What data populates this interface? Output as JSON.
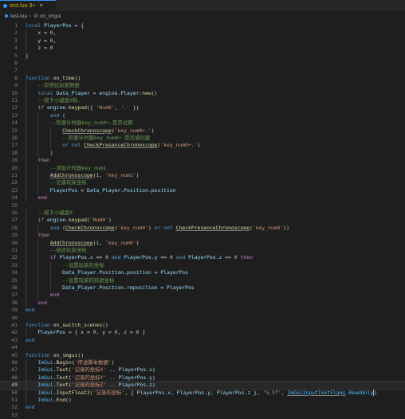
{
  "tab": {
    "name": "test.lua",
    "badge": "9+",
    "close": "×"
  },
  "breadcrumb": {
    "file": "test.lua",
    "separator": "›",
    "fn_icon": "⊘",
    "function": "on_imgui"
  },
  "current_line": 49,
  "lines": [
    [
      {
        "t": "local",
        "c": "kw"
      },
      {
        "t": " "
      },
      {
        "t": "PlayerPos",
        "c": "var"
      },
      {
        "t": " = {"
      }
    ],
    [
      {
        "t": "    "
      },
      {
        "t": "x",
        "c": "var"
      },
      {
        "t": " = "
      },
      {
        "t": "0",
        "c": "num"
      },
      {
        "t": ","
      }
    ],
    [
      {
        "t": "    "
      },
      {
        "t": "y",
        "c": "var"
      },
      {
        "t": " = "
      },
      {
        "t": "0",
        "c": "num"
      },
      {
        "t": ","
      }
    ],
    [
      {
        "t": "    "
      },
      {
        "t": "z",
        "c": "var"
      },
      {
        "t": " = "
      },
      {
        "t": "0",
        "c": "num"
      }
    ],
    [
      {
        "t": "}"
      }
    ],
    [],
    [],
    [
      {
        "t": "function",
        "c": "kw"
      },
      {
        "t": " "
      },
      {
        "t": "on_time",
        "c": "fn"
      },
      {
        "t": "()"
      }
    ],
    [
      {
        "t": "    "
      },
      {
        "t": "--实例化玩家数据",
        "c": "cmt"
      }
    ],
    [
      {
        "t": "    "
      },
      {
        "t": "local",
        "c": "kw"
      },
      {
        "t": " "
      },
      {
        "t": "Data_Player",
        "c": "var"
      },
      {
        "t": " = "
      },
      {
        "t": "engine",
        "c": "var"
      },
      {
        "t": "."
      },
      {
        "t": "Player",
        "c": "var"
      },
      {
        "t": ":"
      },
      {
        "t": "new",
        "c": "fn"
      },
      {
        "t": "()"
      }
    ],
    [
      {
        "t": "    "
      },
      {
        "t": "--按下小键盘0和.",
        "c": "cmt"
      }
    ],
    [
      {
        "t": "    "
      },
      {
        "t": "if",
        "c": "ctl"
      },
      {
        "t": " "
      },
      {
        "t": "engine",
        "c": "var"
      },
      {
        "t": "."
      },
      {
        "t": "keypad",
        "c": "fn"
      },
      {
        "t": "({ "
      },
      {
        "t": "'Num0'",
        "c": "str"
      },
      {
        "t": ", "
      },
      {
        "t": "'.'",
        "c": "str"
      },
      {
        "t": " })"
      }
    ],
    [
      {
        "t": "        "
      },
      {
        "t": "and",
        "c": "kw"
      },
      {
        "t": " ("
      }
    ],
    [
      {
        "t": "        "
      },
      {
        "t": "--检查计时器key_num0+.是否过期",
        "c": "cmt"
      }
    ],
    [
      {
        "t": "            "
      },
      {
        "t": "CheckChronoscope",
        "c": "fn",
        "u": true
      },
      {
        "t": "("
      },
      {
        "t": "'key_num0+.'",
        "c": "str"
      },
      {
        "t": ")"
      }
    ],
    [
      {
        "t": "            "
      },
      {
        "t": "--检查计时器key_num0+.是否被创建",
        "c": "cmt"
      }
    ],
    [
      {
        "t": "            "
      },
      {
        "t": "or",
        "c": "kw"
      },
      {
        "t": " "
      },
      {
        "t": "not",
        "c": "kw"
      },
      {
        "t": " "
      },
      {
        "t": "CheckPresenceChronoscope",
        "c": "fn",
        "u": true
      },
      {
        "t": "("
      },
      {
        "t": "'key_num0+.'",
        "c": "str"
      },
      {
        "t": ")"
      }
    ],
    [
      {
        "t": "        "
      },
      {
        "t": ")"
      }
    ],
    [
      {
        "t": "    "
      },
      {
        "t": "then",
        "c": "ctl"
      }
    ],
    [
      {
        "t": "        "
      },
      {
        "t": "--添加计时器key_num1",
        "c": "cmt"
      }
    ],
    [
      {
        "t": "        "
      },
      {
        "t": "AddChronoscope",
        "c": "fn",
        "u": true
      },
      {
        "t": "("
      },
      {
        "t": "1",
        "c": "num"
      },
      {
        "t": ", "
      },
      {
        "t": "'key_num1'",
        "c": "str"
      },
      {
        "t": ")"
      }
    ],
    [
      {
        "t": "        "
      },
      {
        "t": "--记录玩家坐标",
        "c": "cmt"
      }
    ],
    [
      {
        "t": "        "
      },
      {
        "t": "PlayerPos",
        "c": "var"
      },
      {
        "t": " = "
      },
      {
        "t": "Data_Player",
        "c": "var"
      },
      {
        "t": "."
      },
      {
        "t": "Position",
        "c": "var"
      },
      {
        "t": "."
      },
      {
        "t": "position",
        "c": "var"
      }
    ],
    [
      {
        "t": "    "
      },
      {
        "t": "end",
        "c": "ctl"
      }
    ],
    [],
    [
      {
        "t": "    "
      },
      {
        "t": "--按下小键盘0",
        "c": "cmt"
      }
    ],
    [
      {
        "t": "    "
      },
      {
        "t": "if",
        "c": "ctl"
      },
      {
        "t": " "
      },
      {
        "t": "engine",
        "c": "var"
      },
      {
        "t": "."
      },
      {
        "t": "keypad",
        "c": "fn"
      },
      {
        "t": "("
      },
      {
        "t": "'Num0'",
        "c": "str"
      },
      {
        "t": ")"
      }
    ],
    [
      {
        "t": "        "
      },
      {
        "t": "and",
        "c": "kw"
      },
      {
        "t": " ("
      },
      {
        "t": "CheckChronoscope",
        "c": "fn",
        "u": true
      },
      {
        "t": "("
      },
      {
        "t": "'key_num0'",
        "c": "str"
      },
      {
        "t": ") "
      },
      {
        "t": "or",
        "c": "kw"
      },
      {
        "t": " "
      },
      {
        "t": "not",
        "c": "kw"
      },
      {
        "t": " "
      },
      {
        "t": "CheckPresenceChronoscope",
        "c": "fn",
        "u": true
      },
      {
        "t": "("
      },
      {
        "t": "'key_num0'",
        "c": "str"
      },
      {
        "t": "))"
      }
    ],
    [
      {
        "t": "    "
      },
      {
        "t": "then",
        "c": "ctl"
      }
    ],
    [
      {
        "t": "        "
      },
      {
        "t": "AddChronoscope",
        "c": "fn",
        "u": true
      },
      {
        "t": "("
      },
      {
        "t": "1",
        "c": "num"
      },
      {
        "t": ", "
      },
      {
        "t": "'key_num0'",
        "c": "str"
      },
      {
        "t": ")"
      }
    ],
    [
      {
        "t": "        "
      },
      {
        "t": "--给还玩家坐标",
        "c": "cmt"
      }
    ],
    [
      {
        "t": "        "
      },
      {
        "t": "if",
        "c": "ctl"
      },
      {
        "t": " "
      },
      {
        "t": "PlayerPos",
        "c": "var"
      },
      {
        "t": "."
      },
      {
        "t": "x",
        "c": "var"
      },
      {
        "t": " == "
      },
      {
        "t": "0",
        "c": "num"
      },
      {
        "t": " "
      },
      {
        "t": "and",
        "c": "kw"
      },
      {
        "t": " "
      },
      {
        "t": "PlayerPos",
        "c": "var"
      },
      {
        "t": "."
      },
      {
        "t": "y",
        "c": "var"
      },
      {
        "t": " == "
      },
      {
        "t": "0",
        "c": "num"
      },
      {
        "t": " "
      },
      {
        "t": "and",
        "c": "kw"
      },
      {
        "t": " "
      },
      {
        "t": "PlayerPos",
        "c": "var"
      },
      {
        "t": "."
      },
      {
        "t": "z",
        "c": "var"
      },
      {
        "t": " == "
      },
      {
        "t": "0",
        "c": "num"
      },
      {
        "t": " "
      },
      {
        "t": "then",
        "c": "ctl"
      }
    ],
    [
      {
        "t": "            "
      },
      {
        "t": "--设置玩家的坐标",
        "c": "cmt"
      }
    ],
    [
      {
        "t": "            "
      },
      {
        "t": "Data_Player",
        "c": "var"
      },
      {
        "t": "."
      },
      {
        "t": "Position",
        "c": "var"
      },
      {
        "t": "."
      },
      {
        "t": "position",
        "c": "var"
      },
      {
        "t": " = "
      },
      {
        "t": "PlayerPos",
        "c": "var"
      }
    ],
    [
      {
        "t": "            "
      },
      {
        "t": "--设置玩家的前进坐标",
        "c": "cmt"
      }
    ],
    [
      {
        "t": "            "
      },
      {
        "t": "Data_Player",
        "c": "var"
      },
      {
        "t": "."
      },
      {
        "t": "Position",
        "c": "var"
      },
      {
        "t": "."
      },
      {
        "t": "reposition",
        "c": "var"
      },
      {
        "t": " = "
      },
      {
        "t": "PlayerPos",
        "c": "var"
      }
    ],
    [
      {
        "t": "        "
      },
      {
        "t": "end",
        "c": "ctl"
      }
    ],
    [
      {
        "t": "    "
      },
      {
        "t": "end",
        "c": "ctl"
      }
    ],
    [
      {
        "t": "end",
        "c": "kw"
      }
    ],
    [],
    [
      {
        "t": "function",
        "c": "kw"
      },
      {
        "t": " "
      },
      {
        "t": "on_switch_scenes",
        "c": "fn"
      },
      {
        "t": "()"
      }
    ],
    [
      {
        "t": "    "
      },
      {
        "t": "PlayerPos",
        "c": "var"
      },
      {
        "t": " = { "
      },
      {
        "t": "x",
        "c": "var"
      },
      {
        "t": " = "
      },
      {
        "t": "0",
        "c": "num"
      },
      {
        "t": ", "
      },
      {
        "t": "y",
        "c": "var"
      },
      {
        "t": " = "
      },
      {
        "t": "0",
        "c": "num"
      },
      {
        "t": ", "
      },
      {
        "t": "z",
        "c": "var"
      },
      {
        "t": " = "
      },
      {
        "t": "0",
        "c": "num"
      },
      {
        "t": " }"
      }
    ],
    [
      {
        "t": "end",
        "c": "kw"
      }
    ],
    [],
    [
      {
        "t": "function",
        "c": "kw"
      },
      {
        "t": " "
      },
      {
        "t": "on_imgui",
        "c": "fn"
      },
      {
        "t": "()"
      }
    ],
    [
      {
        "t": "    "
      },
      {
        "t": "ImGui",
        "c": "glb"
      },
      {
        "t": "."
      },
      {
        "t": "Begin",
        "c": "fn"
      },
      {
        "t": "("
      },
      {
        "t": "'传送脚本数据'",
        "c": "str"
      },
      {
        "t": ")"
      }
    ],
    [
      {
        "t": "    "
      },
      {
        "t": "ImGui",
        "c": "glb"
      },
      {
        "t": "."
      },
      {
        "t": "Text",
        "c": "fn"
      },
      {
        "t": "("
      },
      {
        "t": "'记录的坐标X' ",
        "c": "str"
      },
      {
        "t": ".. "
      },
      {
        "t": "PlayerPos",
        "c": "var"
      },
      {
        "t": "."
      },
      {
        "t": "x",
        "c": "var"
      },
      {
        "t": ")"
      }
    ],
    [
      {
        "t": "    "
      },
      {
        "t": "ImGui",
        "c": "glb"
      },
      {
        "t": "."
      },
      {
        "t": "Text",
        "c": "fn"
      },
      {
        "t": "("
      },
      {
        "t": "'记录的坐标Y' ",
        "c": "str"
      },
      {
        "t": ".. "
      },
      {
        "t": "PlayerPos",
        "c": "var"
      },
      {
        "t": "."
      },
      {
        "t": "y",
        "c": "var"
      },
      {
        "t": ")"
      }
    ],
    [
      {
        "t": "    "
      },
      {
        "t": "ImGui",
        "c": "glb"
      },
      {
        "t": "."
      },
      {
        "t": "Text",
        "c": "fn"
      },
      {
        "t": "("
      },
      {
        "t": "'记录的坐标Z' ",
        "c": "str"
      },
      {
        "t": ".. "
      },
      {
        "t": "PlayerPos",
        "c": "var"
      },
      {
        "t": "."
      },
      {
        "t": "z",
        "c": "var"
      },
      {
        "t": ")"
      }
    ],
    [
      {
        "t": "    "
      },
      {
        "t": "ImGui",
        "c": "glb"
      },
      {
        "t": "."
      },
      {
        "t": "InputFloat3",
        "c": "fn"
      },
      {
        "t": "("
      },
      {
        "t": "'记录的坐标'",
        "c": "str"
      },
      {
        "t": ", { "
      },
      {
        "t": "PlayerPos",
        "c": "var"
      },
      {
        "t": "."
      },
      {
        "t": "x",
        "c": "var"
      },
      {
        "t": ", "
      },
      {
        "t": "PlayerPos",
        "c": "var"
      },
      {
        "t": "."
      },
      {
        "t": "y",
        "c": "var"
      },
      {
        "t": ", "
      },
      {
        "t": "PlayerPos",
        "c": "var"
      },
      {
        "t": "."
      },
      {
        "t": "z",
        "c": "var"
      },
      {
        "t": " }, "
      },
      {
        "t": "'%.5f'",
        "c": "str"
      },
      {
        "t": ", "
      },
      {
        "t": "ImGuiInputTextFlags",
        "c": "glb",
        "u": true
      },
      {
        "t": "."
      },
      {
        "t": "ReadOnly",
        "c": "glb"
      },
      {
        "t": ")",
        "k": true
      }
    ],
    [
      {
        "t": "    "
      },
      {
        "t": "ImGui",
        "c": "glb"
      },
      {
        "t": "."
      },
      {
        "t": "End",
        "c": "fn"
      },
      {
        "t": "()"
      }
    ],
    [
      {
        "t": "end",
        "c": "kw"
      }
    ],
    []
  ]
}
